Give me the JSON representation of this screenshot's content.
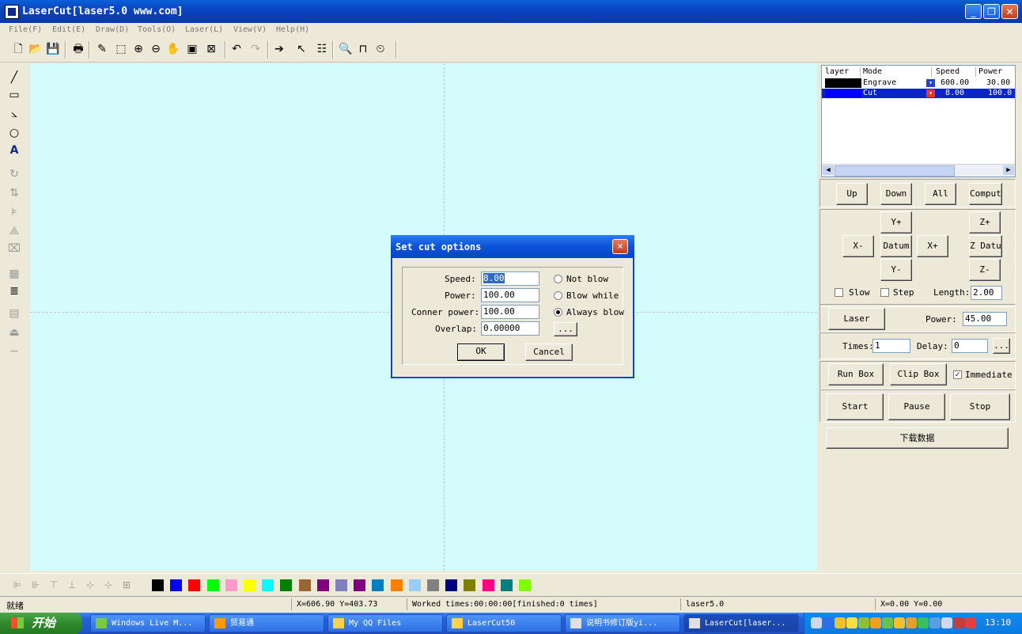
{
  "window": {
    "title": "LaserCut[laser5.0 www.com]",
    "min": "_",
    "restore": "❐",
    "close": "✕"
  },
  "menu": [
    "File(F)",
    "Edit(E)",
    "Draw(D)",
    "Tools(O)",
    "Laser(L)",
    "View(V)",
    "Help(H)"
  ],
  "toolbar_icons": [
    "new-icon",
    "open-icon",
    "save-icon",
    "print-icon",
    "pen-icon",
    "select-icon",
    "zoom-in-icon",
    "zoom-out-icon",
    "pan-icon",
    "fit-icon",
    "fit-page-icon",
    "undo-icon",
    "redo-icon",
    "arrow-icon",
    "node-icon",
    "list-icon",
    "preview-icon",
    "cut-icon",
    "timer-icon"
  ],
  "toolbar_glyphs": [
    "🗋",
    "📂",
    "💾",
    "🖶",
    "✎",
    "⬚",
    "⊕",
    "⊖",
    "✋",
    "▣",
    "⊠",
    "↶",
    "↷",
    "➔",
    "↖",
    "☷",
    "🔍",
    "⊓",
    "⏲"
  ],
  "left_tools": [
    {
      "icon": "line-icon",
      "glyph": "╱",
      "dim": false
    },
    {
      "icon": "rectangle-icon",
      "glyph": "▭",
      "dim": false
    },
    {
      "icon": "polyline-icon",
      "glyph": "⦣",
      "dim": false
    },
    {
      "icon": "ellipse-icon",
      "glyph": "○",
      "dim": false
    },
    {
      "icon": "text-icon",
      "glyph": "A",
      "dim": false
    },
    {
      "icon": "rotate-icon",
      "glyph": "↻",
      "dim": true
    },
    {
      "icon": "mirror-icon",
      "glyph": "⇅",
      "dim": true
    },
    {
      "icon": "align-icon",
      "glyph": "⊧",
      "dim": true
    },
    {
      "icon": "node-edit-icon",
      "glyph": "⟁",
      "dim": true
    },
    {
      "icon": "crop-icon",
      "glyph": "⌧",
      "dim": true
    },
    {
      "icon": "array-icon",
      "glyph": "▦",
      "dim": true
    },
    {
      "icon": "fill-icon",
      "glyph": "≣",
      "dim": false
    },
    {
      "icon": "engrave-icon",
      "glyph": "▤",
      "dim": true
    },
    {
      "icon": "weld-icon",
      "glyph": "⏏",
      "dim": true
    },
    {
      "icon": "curve-icon",
      "glyph": "∼",
      "dim": true
    }
  ],
  "layers": {
    "headers": [
      "layer",
      "Mode",
      "Speed",
      "Power"
    ],
    "rows": [
      {
        "color": "#000000",
        "mode": "Engrave",
        "speed": "600.00",
        "power": "30.00",
        "selected": false
      },
      {
        "color": "#0000ff",
        "mode": "Cut",
        "speed": "8.00",
        "power": "100.0",
        "selected": true
      }
    ]
  },
  "panel": {
    "up": "Up",
    "down": "Down",
    "all": "All",
    "compute": "Compute",
    "yplus": "Y+",
    "zplus": "Z+",
    "xminus": "X-",
    "datum": "Datum",
    "xplus": "X+",
    "zdatum": "Z Datum",
    "yminus": "Y-",
    "zminus": "Z-",
    "slow": "Slow",
    "step": "Step",
    "length_label": "Length:",
    "length_value": "2.00",
    "laser": "Laser",
    "power_label": "Power:",
    "power_value": "45.00",
    "times_label": "Times:",
    "times_value": "1",
    "delay_label": "Delay:",
    "delay_value": "0",
    "ellipsis": "...",
    "runbox": "Run Box",
    "clipbox": "Clip Box",
    "immediate": "Immediate",
    "immediate_checked": true,
    "start": "Start",
    "pause": "Pause",
    "stop": "Stop",
    "download": "下载数据"
  },
  "dialog": {
    "title": "Set cut options",
    "speed_label": "Speed:",
    "speed_value": "8.00",
    "power_label": "Power:",
    "power_value": "100.00",
    "conner_label": "Conner power:",
    "conner_value": "100.00",
    "overlap_label": "Overlap:",
    "overlap_value": "0.00000",
    "radio_not_blow": "Not blow",
    "radio_blow_while": "Blow while",
    "radio_always_blow": "Always blow",
    "selected_radio": "Always blow",
    "ellipsis": "...",
    "ok": "OK",
    "cancel": "Cancel"
  },
  "palette_colors": [
    "#000000",
    "#0000ff",
    "#ff0000",
    "#00ff00",
    "#ff99cc",
    "#ffff00",
    "#00ffff",
    "#008000",
    "#996633",
    "#800080",
    "#8080c0",
    "#800080",
    "#0080c0",
    "#ff8000",
    "#99ccff",
    "#808080",
    "#000080",
    "#808000",
    "#ff0080",
    "#008080",
    "#80ff00"
  ],
  "status": {
    "ready": "就绪",
    "coords": "X=606.90 Y=403.73",
    "worked": "Worked times:00:00:00[finished:0 times]",
    "device": "laser5.0",
    "pos": "X=0.00 Y=0.00"
  },
  "taskbar": {
    "start": "开始",
    "tasks": [
      {
        "label": "Windows Live M...",
        "icon_color": "#7ac943",
        "active": false
      },
      {
        "label": "贸易通",
        "icon_color": "#ff9900",
        "active": false
      },
      {
        "label": "My QQ Files",
        "icon_color": "#ffd24a",
        "active": false
      },
      {
        "label": "LaserCut50",
        "icon_color": "#ffd24a",
        "active": false
      },
      {
        "label": "说明书修订版yi...",
        "icon_color": "#e0e0e0",
        "active": false
      },
      {
        "label": "LaserCut[laser...",
        "icon_color": "#e0e0e0",
        "active": true
      }
    ],
    "clock": "13:10"
  }
}
